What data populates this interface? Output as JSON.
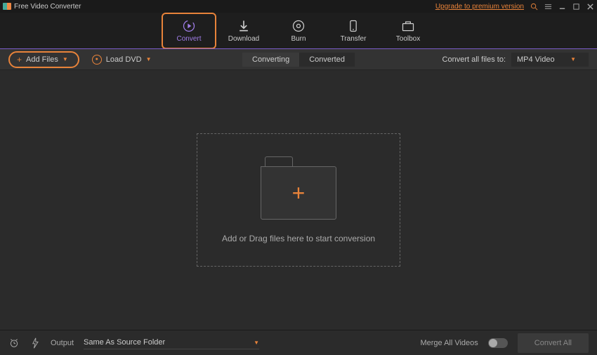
{
  "titlebar": {
    "title": "Free Video Converter",
    "upgrade": "Upgrade to premium version"
  },
  "nav": {
    "convert": "Convert",
    "download": "Download",
    "burn": "Burn",
    "transfer": "Transfer",
    "toolbox": "Toolbox"
  },
  "toolbar": {
    "add_files": "Add Files",
    "load_dvd": "Load DVD",
    "tab_converting": "Converting",
    "tab_converted": "Converted",
    "convert_all_label": "Convert all files to:",
    "format": "MP4 Video"
  },
  "main": {
    "drop_text": "Add or Drag files here to start conversion"
  },
  "footer": {
    "output_label": "Output",
    "output_path": "Same As Source Folder",
    "merge_label": "Merge All Videos",
    "convert_all": "Convert All"
  }
}
